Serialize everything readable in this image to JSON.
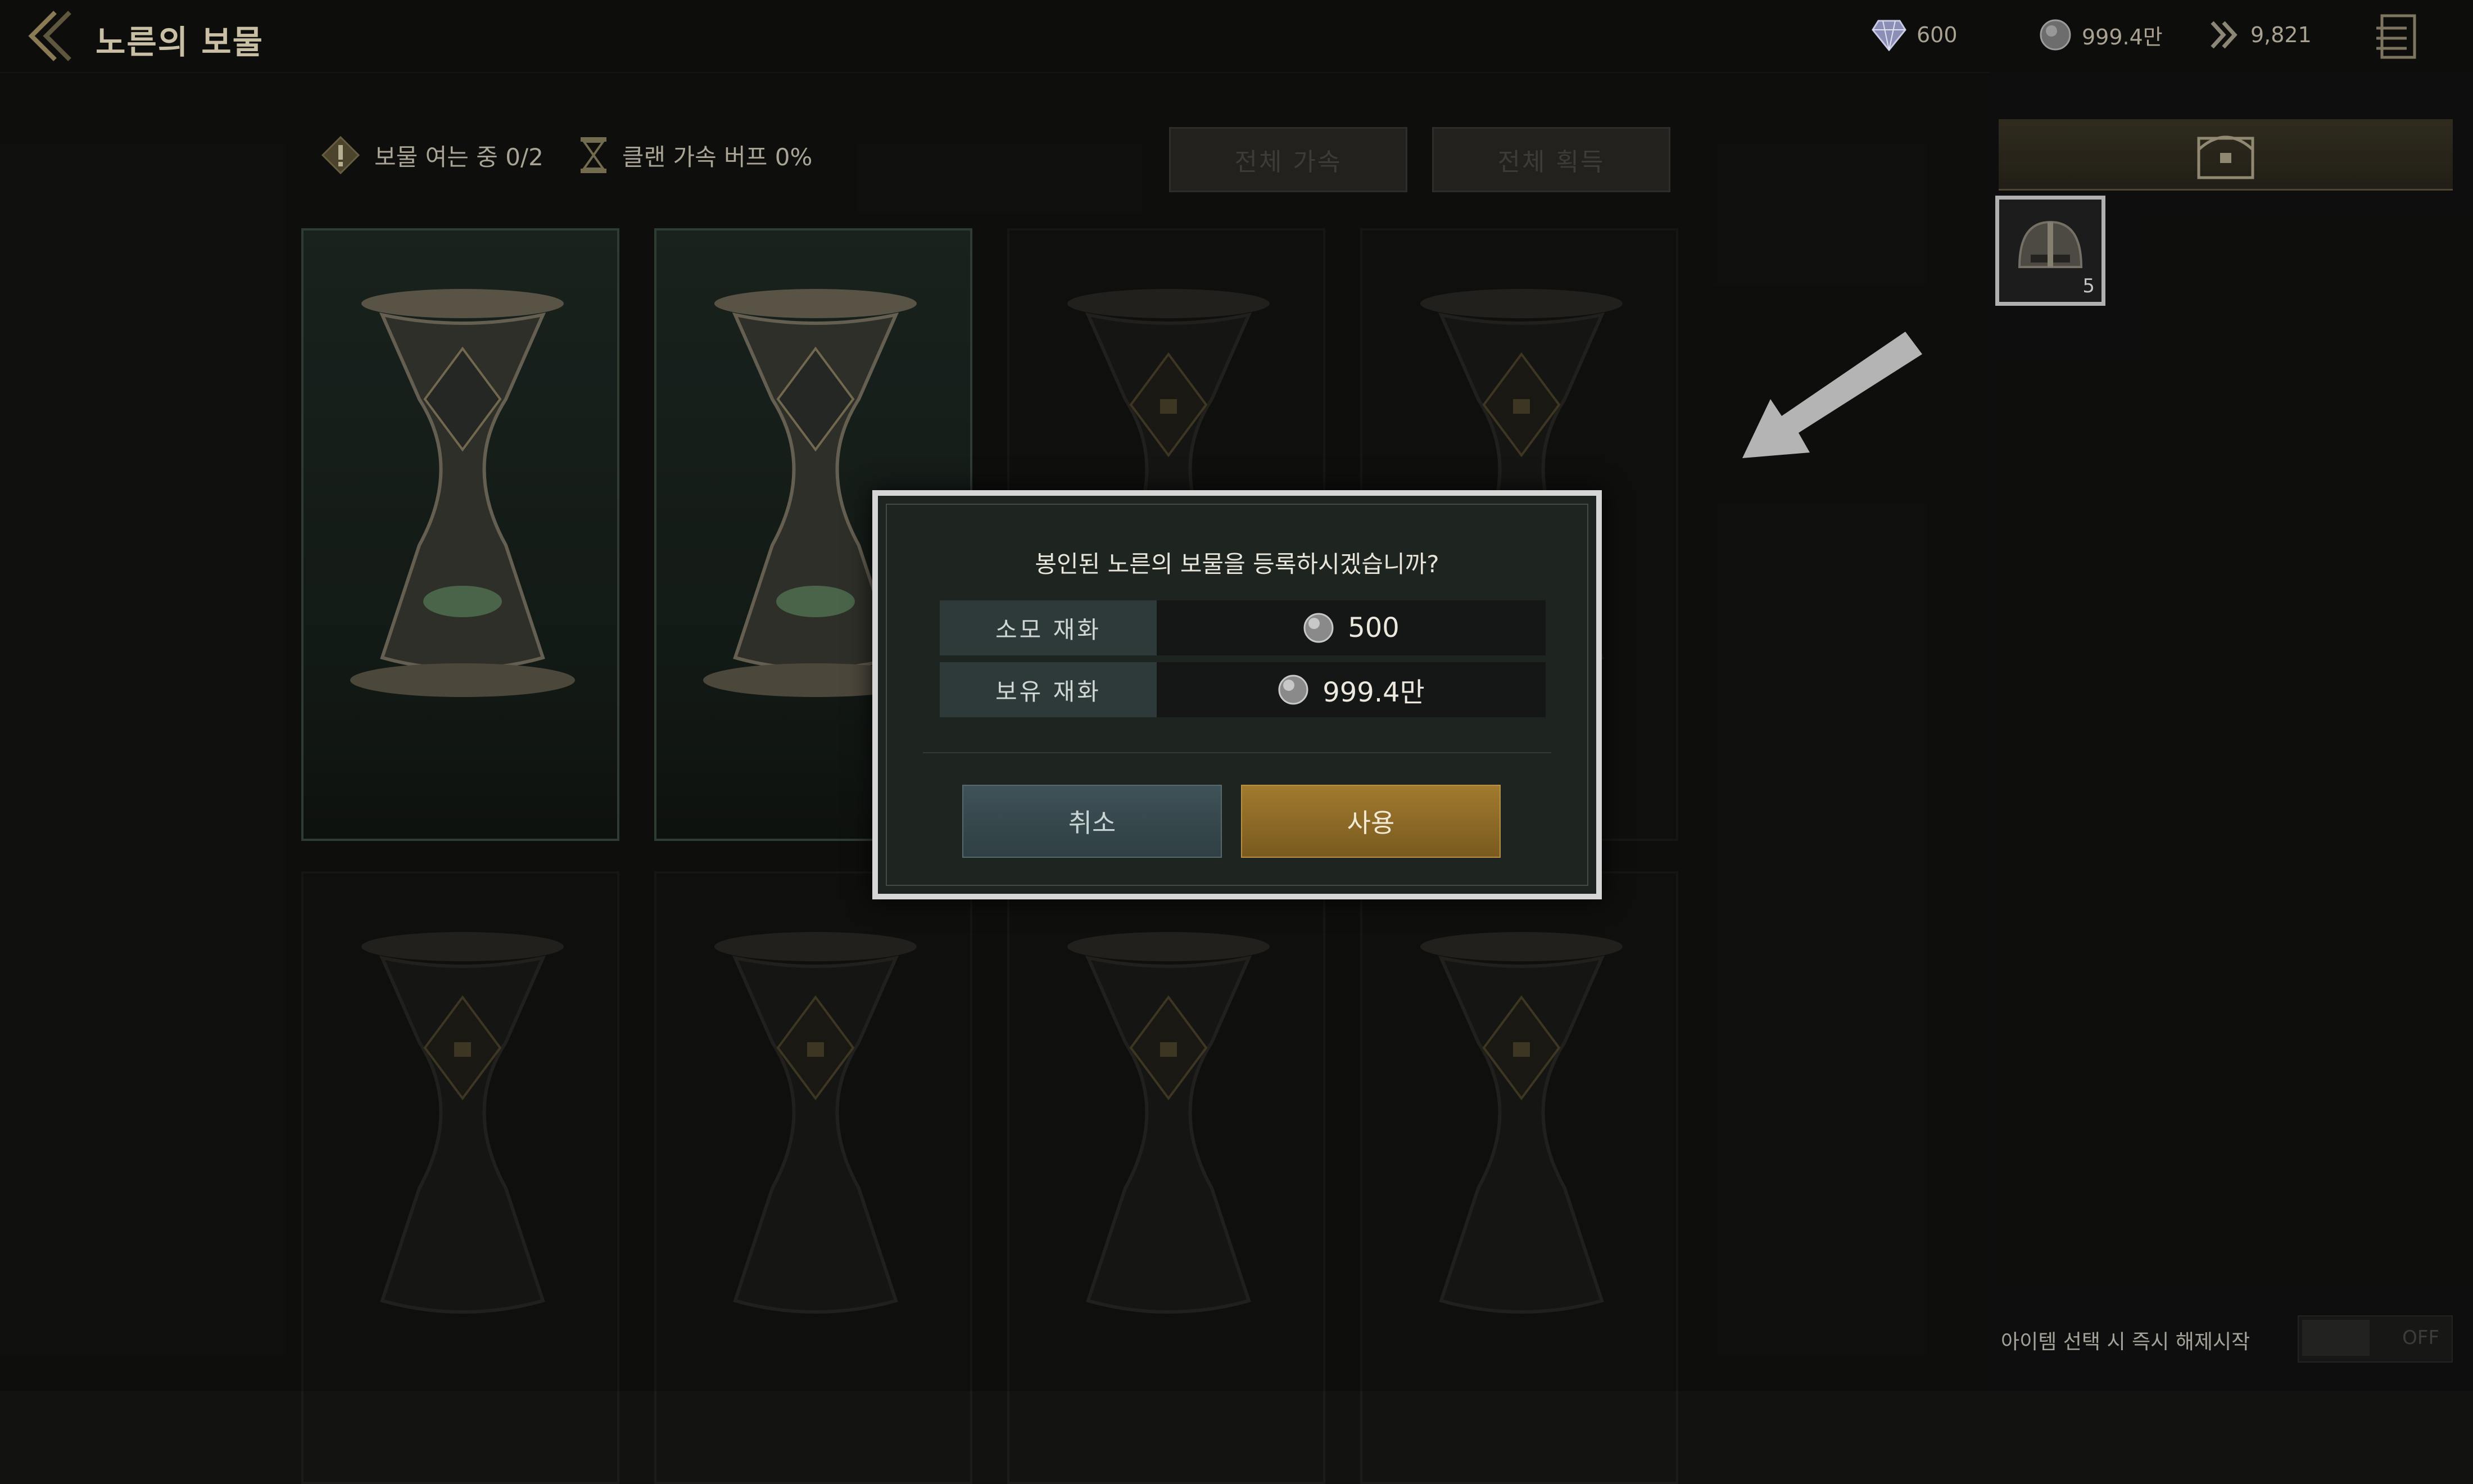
{
  "header": {
    "title": "노른의 보물",
    "currencies": [
      {
        "icon": "diamond-icon",
        "value": "600"
      },
      {
        "icon": "silver-coin-icon",
        "value": "999.4만"
      },
      {
        "icon": "chevron-arrow-icon",
        "value": "9,821"
      }
    ]
  },
  "status": {
    "opening": "보물 여는 중 0/2",
    "clan_buff": "클랜 가속 버프 0%"
  },
  "actions": {
    "speed_all": "전체 가속",
    "obtain_all": "전체 획득"
  },
  "dialog": {
    "message": "봉인된 노른의 보물을 등록하시겠습니까?",
    "cost_label": "소모 재화",
    "cost_value": "500",
    "owned_label": "보유 재화",
    "owned_value": "999.4만",
    "cancel": "취소",
    "use": "사용"
  },
  "inventory": {
    "item_count": "5"
  },
  "footer": {
    "instant_unlock_label": "아이템 선택 시 즉시 해제시작",
    "toggle_state": "OFF"
  },
  "colors": {
    "accent_gold": "#a07a2e",
    "dialog_border": "#d6d6d6",
    "cancel_teal": "#3f5257"
  }
}
